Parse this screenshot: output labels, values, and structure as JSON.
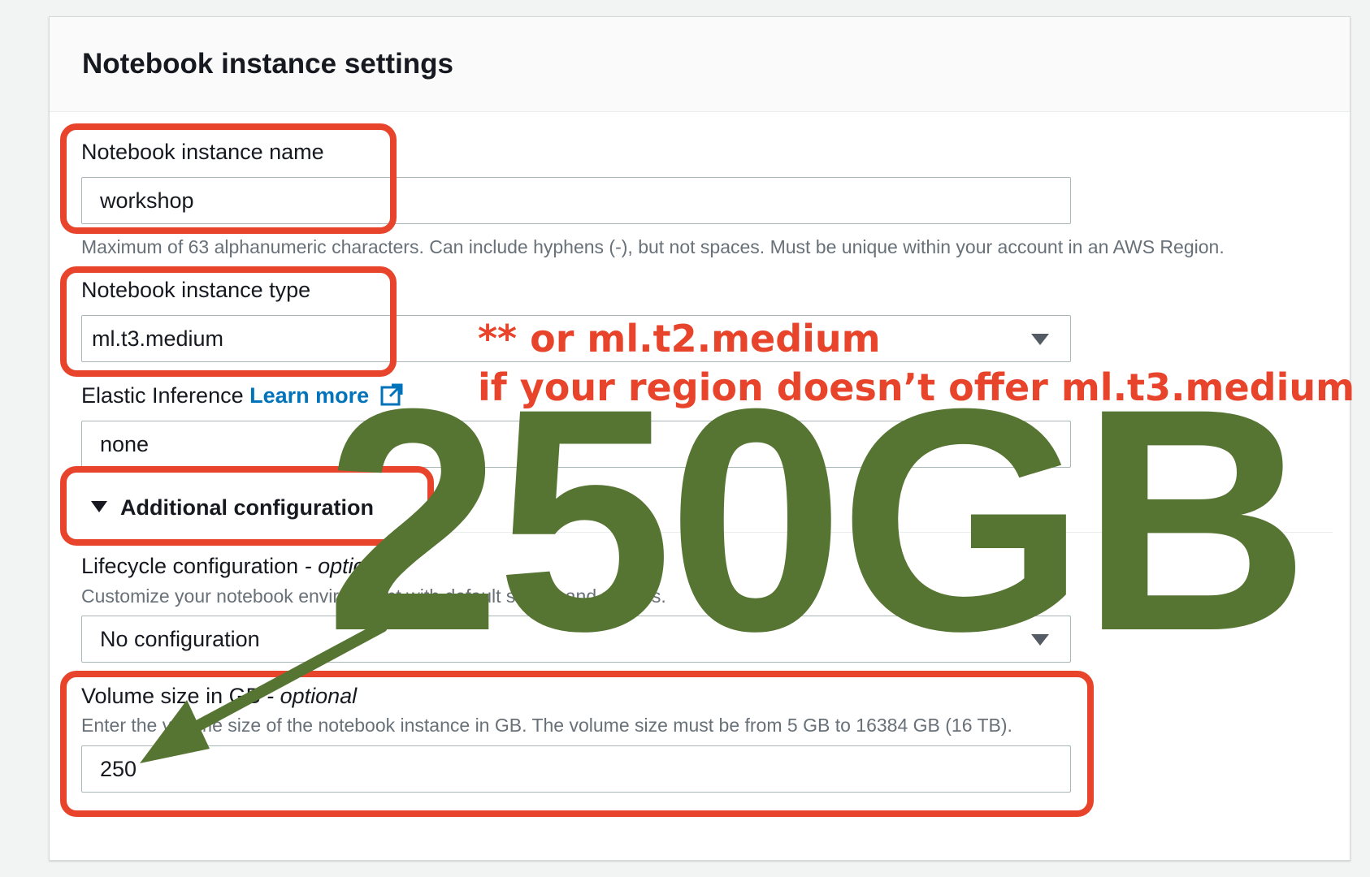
{
  "panel": {
    "title": "Notebook instance settings"
  },
  "name_field": {
    "label": "Notebook instance name",
    "value": "workshop",
    "hint": "Maximum of 63 alphanumeric characters. Can include hyphens (-), but not spaces. Must be unique within your account in an AWS Region."
  },
  "type_field": {
    "label": "Notebook instance type",
    "value": "ml.t3.medium"
  },
  "elastic_field": {
    "label": "Elastic Inference",
    "link": "Learn more",
    "value": "none"
  },
  "additional": {
    "label": "Additional configuration"
  },
  "lifecycle_field": {
    "label": "Lifecycle configuration",
    "optional": " - optional",
    "hint": "Customize your notebook environment with default scripts and plugins.",
    "value": "No configuration"
  },
  "volume_field": {
    "label": "Volume size in GB",
    "optional": " - optional",
    "hint": "Enter the volume size of the notebook instance in GB. The volume size must be from 5 GB to 16384 GB (16 TB).",
    "value": "250"
  },
  "annotations": {
    "note_line1": "** or ml.t2.medium",
    "note_line2": "if your region doesn’t offer ml.t3.medium",
    "big_label": "250GB",
    "highlight_color": "#e8442b",
    "big_color": "#577532"
  },
  "icons": {
    "external_link": "external-link-icon",
    "dropdown": "caret-down-icon",
    "expander": "caret-expanded-icon"
  }
}
